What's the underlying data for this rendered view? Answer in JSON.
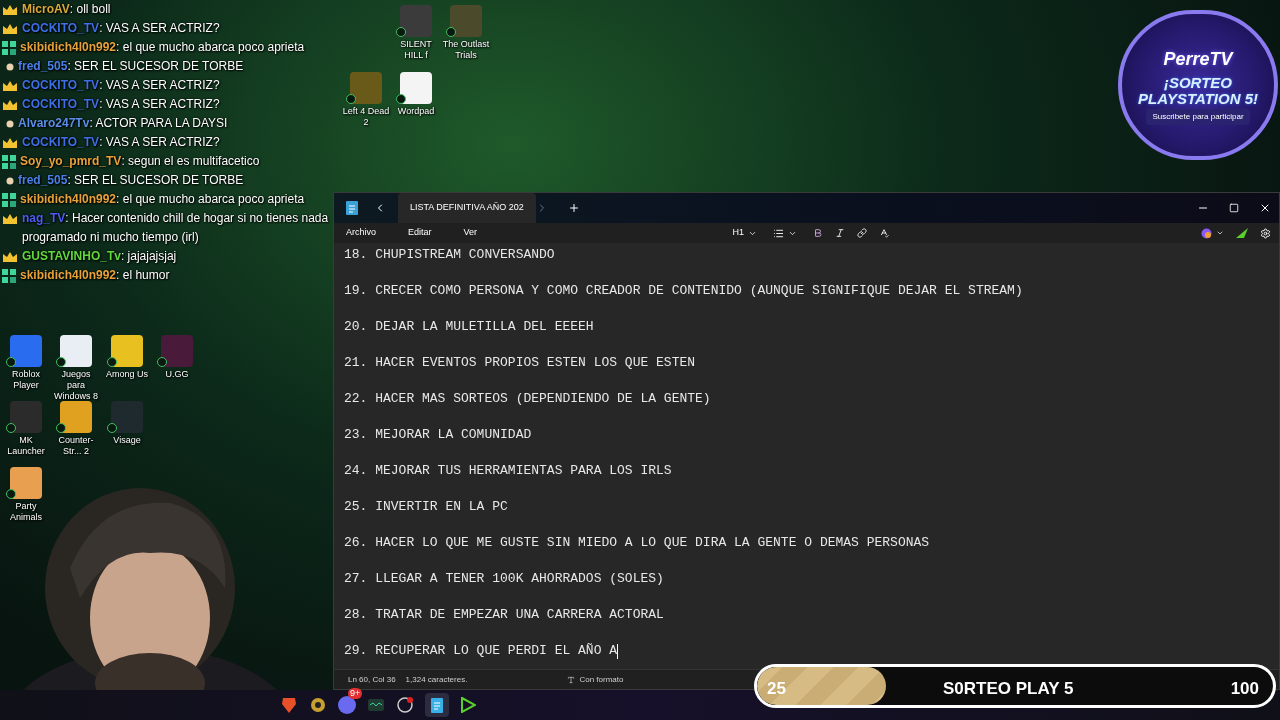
{
  "chat": [
    {
      "user": "MicroAV",
      "color": "#d9a93c",
      "kind": "crown",
      "text": ": oll boll"
    },
    {
      "user": "COCKITO_TV",
      "color": "#3f6fe6",
      "kind": "crown",
      "text": ": VAS A SER ACTRIZ?"
    },
    {
      "user": "skibidich4l0n992",
      "color": "#e8a23a",
      "kind": "sub",
      "text": ": el que mucho abarca poco aprieta"
    },
    {
      "user": "fred_505",
      "color": "#4a80e8",
      "kind": "dot",
      "text": ": SER EL SUCESOR DE TORBE"
    },
    {
      "user": "COCKITO_TV",
      "color": "#3f6fe6",
      "kind": "crown",
      "text": ": VAS A SER ACTRIZ?"
    },
    {
      "user": "COCKITO_TV",
      "color": "#3f6fe6",
      "kind": "crown",
      "text": ": VAS A SER ACTRIZ?"
    },
    {
      "user": "Alvaro247Tv",
      "color": "#5b8fe8",
      "kind": "dot",
      "text": ": ACTOR PARA LA DAYSI"
    },
    {
      "user": "COCKITO_TV",
      "color": "#3f6fe6",
      "kind": "crown",
      "text": ": VAS A SER ACTRIZ?"
    },
    {
      "user": "Soy_yo_pmrd_TV",
      "color": "#e8a23a",
      "kind": "sub",
      "text": ": segun el es multifacetico"
    },
    {
      "user": "fred_505",
      "color": "#4a80e8",
      "kind": "dot",
      "text": ": SER EL SUCESOR DE TORBE"
    },
    {
      "user": "skibidich4l0n992",
      "color": "#e8a23a",
      "kind": "sub",
      "text": ": el que mucho abarca poco aprieta"
    },
    {
      "user": "nag_TV",
      "color": "#4b5cf0",
      "kind": "crown",
      "text": ": Hacer contenido chill de hogar si no tienes nada programado ni mucho tiempo (irl)"
    },
    {
      "user": "GUSTAVINHO_Tv",
      "color": "#62d83c",
      "kind": "crown",
      "text": ": jajajajsjaj"
    },
    {
      "user": "skibidich4l0n992",
      "color": "#e8a23a",
      "kind": "sub",
      "text": ": el humor"
    }
  ],
  "desktop_icons": [
    {
      "label": "SILENT HILL f"
    },
    {
      "label": "The Outlast Trials"
    },
    {
      "label": "Left 4 Dead 2"
    },
    {
      "label": "Wordpad"
    },
    {
      "label": "Roblox Player"
    },
    {
      "label": "Juegos para Windows 8"
    },
    {
      "label": "Among Us"
    },
    {
      "label": "U.GG"
    },
    {
      "label": "MK Launcher"
    },
    {
      "label": "Counter-Str... 2"
    },
    {
      "label": "Visage"
    },
    {
      "label": "Party Animals"
    }
  ],
  "giveaway": {
    "brand": "PerreTV",
    "title": "¡SORTEO PLAYSTATION 5!",
    "subtitle": "Suscribete para participar"
  },
  "notepad": {
    "tab": "LISTA DEFINITIVA AÑO 202",
    "menu": [
      "Archivo",
      "Editar",
      "Ver"
    ],
    "heading": "H1",
    "lines": [
      "18. CHUPISTREAM CONVERSANDO",
      "19. CRECER COMO PERSONA Y COMO CREADOR DE CONTENIDO (AUNQUE SIGNIFIQUE DEJAR EL STREAM)",
      "20. DEJAR LA MULETILLA DEL EEEEH",
      "21. HACER EVENTOS PROPIOS ESTEN LOS QUE ESTEN",
      "22. HACER MAS SORTEOS (DEPENDIENDO DE LA GENTE)",
      "23. MEJORAR LA COMUNIDAD",
      "24. MEJORAR TUS HERRAMIENTAS PARA LOS IRLS",
      "25. INVERTIR EN LA PC",
      "26. HACER LO QUE ME GUSTE SIN MIEDO A LO QUE DIRA LA GENTE O DEMAS PERSONAS",
      "27. LLEGAR A TENER 100K AHORRADOS (SOLES)",
      "28. TRATAR DE EMPEZAR UNA CARRERA ACTORAL",
      "29. RECUPERAR LO QUE PERDI EL AÑO A"
    ],
    "status": {
      "position": "Ln 60, Col 36",
      "chars": "1,324 caracteres.",
      "format": "Con formato"
    }
  },
  "goal_bar": {
    "current": "25",
    "title": "S0RTEO PLAY 5",
    "target": "100",
    "level": 0.25
  },
  "taskbar": {
    "discord_badge": "9+"
  }
}
